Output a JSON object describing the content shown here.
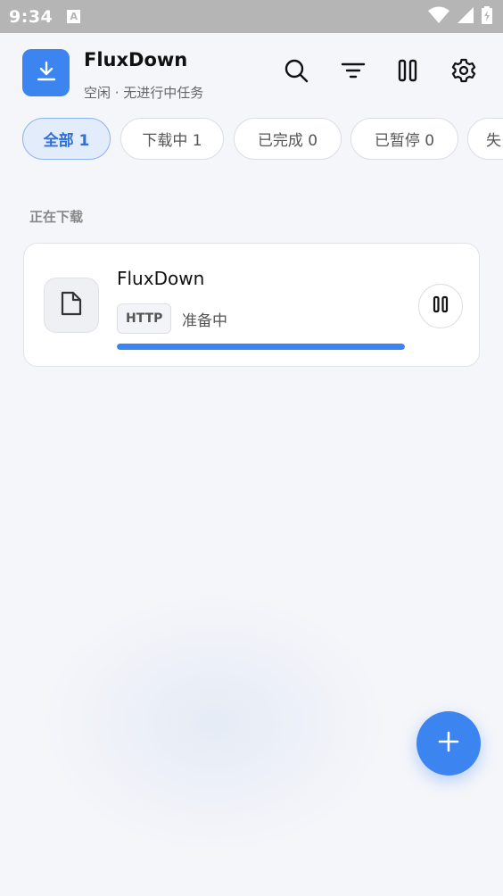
{
  "status_bar": {
    "time": "9:34",
    "notification_letter": "A"
  },
  "app": {
    "title": "FluxDown",
    "subtitle": "空闲 · 无进行中任务"
  },
  "header_actions": [
    "search-icon",
    "filter-icon",
    "pause-all-icon",
    "gear-icon"
  ],
  "filters": [
    {
      "label": "全部 1",
      "active": true
    },
    {
      "label": "下载中 1",
      "active": false
    },
    {
      "label": "已完成 0",
      "active": false
    },
    {
      "label": "已暂停 0",
      "active": false
    },
    {
      "label": "失",
      "active": false
    }
  ],
  "section": {
    "label": "正在下载"
  },
  "downloads": [
    {
      "name": "FluxDown",
      "protocol": "HTTP",
      "status": "准备中",
      "progress": 1.0
    }
  ],
  "colors": {
    "accent": "#3c84f0",
    "active_chip_bg": "#e2ecfb",
    "background": "#f5f6fa"
  }
}
